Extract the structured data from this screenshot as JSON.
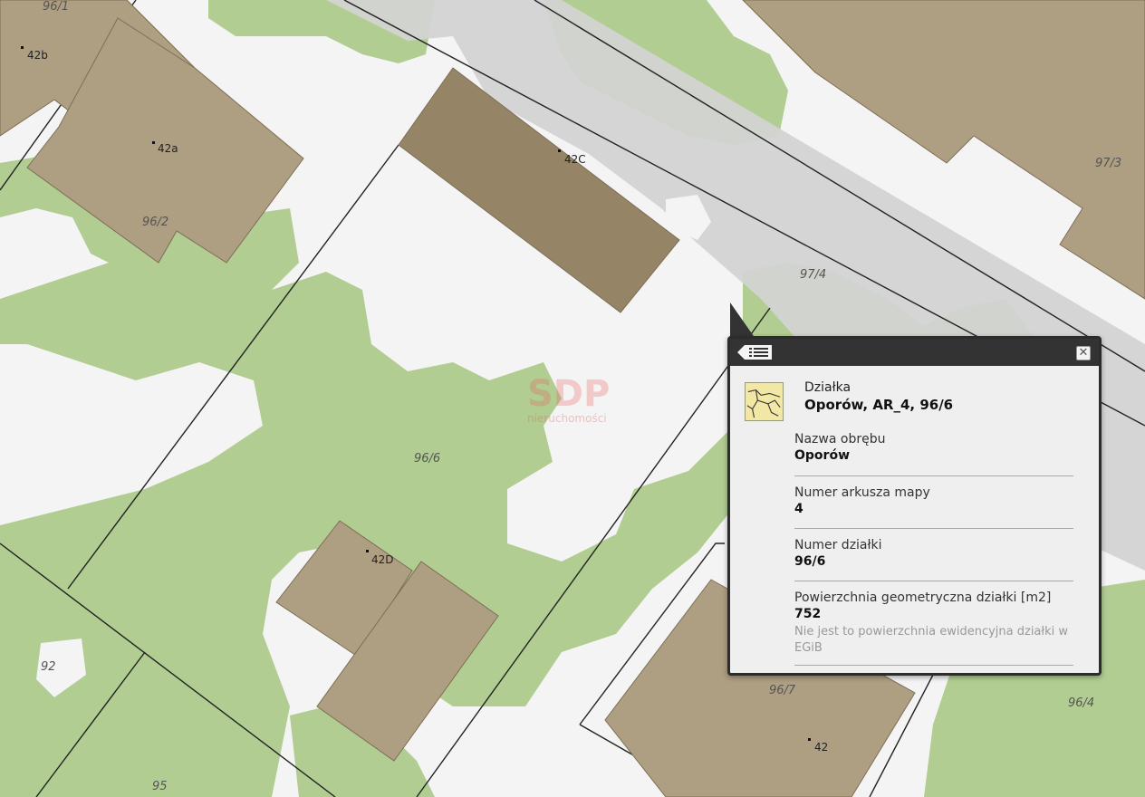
{
  "map": {
    "parcel_labels": [
      "96/1",
      "96/2",
      "97/4",
      "97/3",
      "96/6",
      "92",
      "95",
      "96/7",
      "96/4"
    ],
    "address_labels": [
      "42b",
      "42a",
      "42C",
      "42D",
      "42"
    ],
    "watermark": {
      "title": "SDP",
      "subtitle": "nieruchomości"
    }
  },
  "popup": {
    "header": {
      "back_icon": "list-back-icon",
      "close_icon": "close-icon",
      "close_glyph": "✕"
    },
    "parcel_icon": "parcel-map-icon",
    "type": "Działka",
    "title": "Oporów, AR_4, 96/6",
    "fields": [
      {
        "label": "Nazwa obrębu",
        "value": "Oporów"
      },
      {
        "label": "Numer arkusza mapy",
        "value": "4"
      },
      {
        "label": "Numer działki",
        "value": "96/6"
      },
      {
        "label": "Powierzchnia geometryczna działki [m2]",
        "value": "752",
        "note": "Nie jest to powierzchnia ewidencyjna działki w EGiB"
      }
    ]
  },
  "colors": {
    "background": "#f4f4f4",
    "vegetation": "#b1cd92",
    "building": "#ae9e82",
    "building_dark": "#958466",
    "road": "#d3d3d3",
    "popup_header": "#333333"
  }
}
